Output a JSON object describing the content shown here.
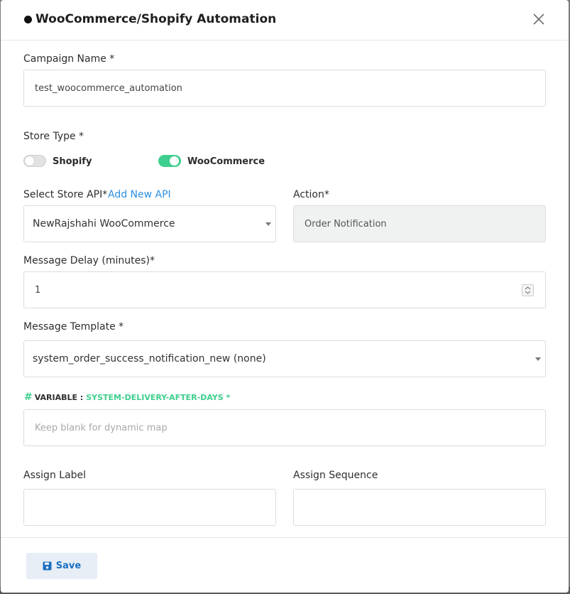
{
  "modal": {
    "title": "WooCommerce/Shopify Automation"
  },
  "campaign_name": {
    "label": "Campaign Name *",
    "value": "test_woocommerce_automation"
  },
  "store_type": {
    "label": "Store Type *",
    "options": [
      {
        "label": "Shopify",
        "checked": false
      },
      {
        "label": "WooCommerce",
        "checked": true
      }
    ]
  },
  "store_api": {
    "label": "Select Store API*",
    "add_link": "Add New API",
    "selected": "NewRajshahi WooCommerce"
  },
  "action": {
    "label": "Action*",
    "value": "Order Notification"
  },
  "message_delay": {
    "label": "Message Delay (minutes)*",
    "value": "1"
  },
  "message_template": {
    "label": "Message Template *",
    "selected": "system_order_success_notification_new (none)"
  },
  "variable": {
    "hash": "#",
    "label": "VARIABLE :",
    "name": "SYSTEM-DELIVERY-AFTER-DAYS *",
    "placeholder": "Keep blank for dynamic map"
  },
  "assign_label": {
    "label": "Assign Label",
    "value": ""
  },
  "assign_sequence": {
    "label": "Assign Sequence",
    "value": ""
  },
  "footer": {
    "save_label": "Save"
  },
  "colors": {
    "accent_green": "#3ecf8e",
    "link_blue": "#2d8fe0",
    "save_text": "#1b6fc2"
  },
  "icons": {
    "close": "close-icon",
    "save": "floppy-disk-icon",
    "caret": "chevron-down-icon"
  }
}
